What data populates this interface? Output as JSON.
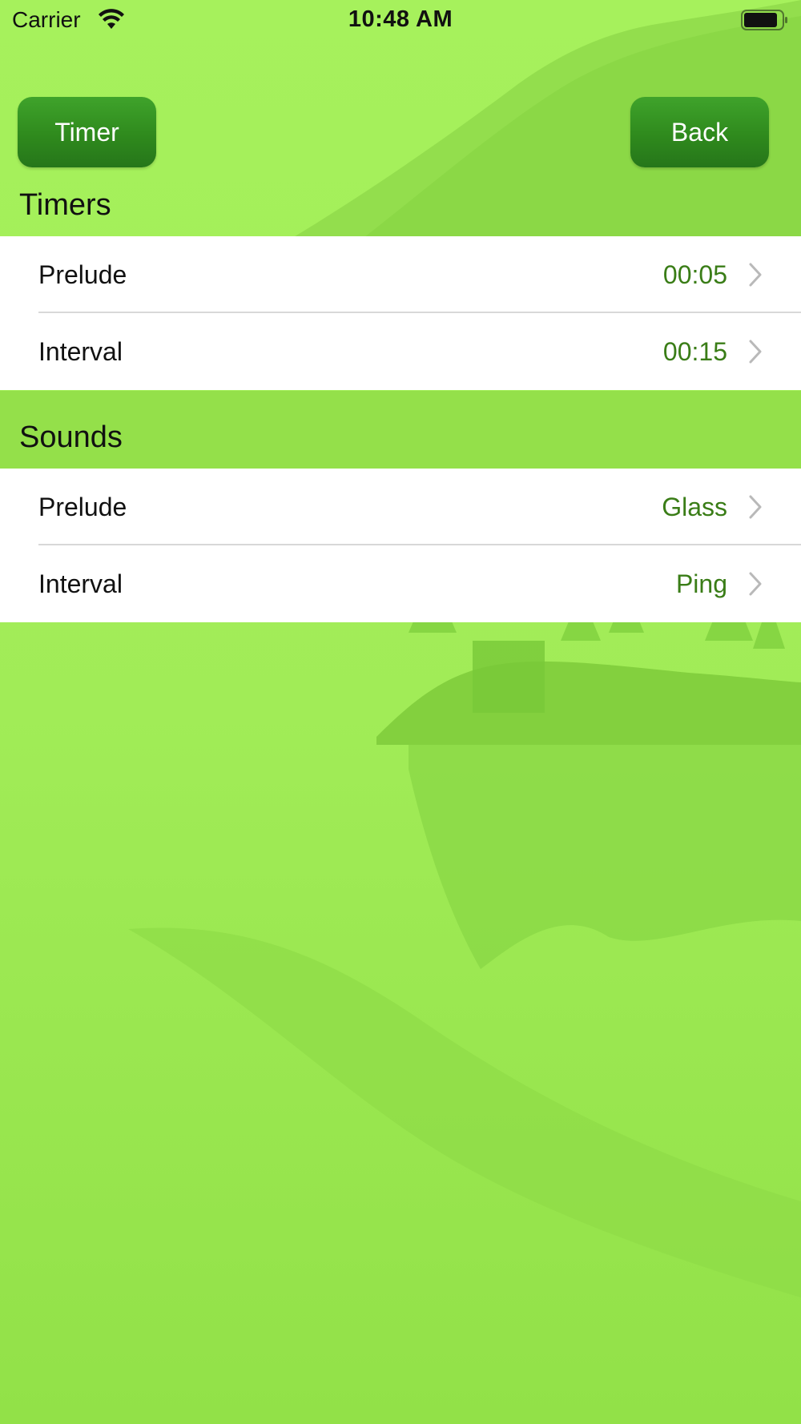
{
  "status_bar": {
    "carrier": "Carrier",
    "time": "10:48 AM",
    "wifi_icon": "wifi-icon",
    "battery_icon": "battery-icon"
  },
  "nav": {
    "timer_label": "Timer",
    "back_label": "Back"
  },
  "sections": {
    "timers": {
      "title": "Timers",
      "rows": [
        {
          "label": "Prelude",
          "value": "00:05"
        },
        {
          "label": "Interval",
          "value": "00:15"
        }
      ]
    },
    "sounds": {
      "title": "Sounds",
      "rows": [
        {
          "label": "Prelude",
          "value": "Glass"
        },
        {
          "label": "Interval",
          "value": "Ping"
        }
      ]
    }
  },
  "colors": {
    "background": "#a3ef5a",
    "button": "#2f8a1d",
    "value_text": "#3a7d17"
  }
}
